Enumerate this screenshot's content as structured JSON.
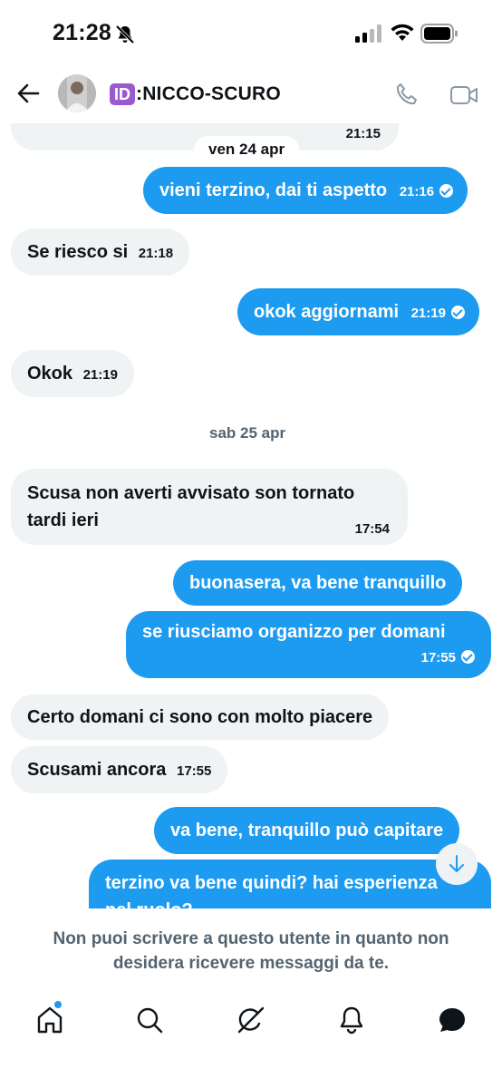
{
  "status_bar": {
    "time": "21:28"
  },
  "header": {
    "badge": "ID",
    "name": ":NICCO-SCURO"
  },
  "messages": [
    {
      "text": "",
      "time": "21:15"
    },
    {
      "text": "vieni terzino, dai ti aspetto",
      "time": "21:16"
    },
    {
      "text": "Se riesco si",
      "time": "21:18"
    },
    {
      "text": "okok aggiornami",
      "time": "21:19"
    },
    {
      "text": "Okok",
      "time": "21:19"
    },
    {
      "text_line1": "Scusa non averti avvisato son tornato",
      "text_line2": "tardi ieri",
      "time": "17:54"
    },
    {
      "text": "buonasera, va bene tranquillo"
    },
    {
      "text": "se riusciamo organizzo per domani",
      "time": "17:55"
    },
    {
      "text": "Certo domani ci sono con molto piacere"
    },
    {
      "text": "Scusami ancora",
      "time": "17:55"
    },
    {
      "text": "va bene, tranquillo può capitare"
    },
    {
      "text_line1": "terzino va bene quindi? hai esperienza",
      "text_line2": "nel ruolo?"
    }
  ],
  "dates": {
    "first": "ven 24 apr",
    "second": "sab 25 apr"
  },
  "notice": {
    "line1": "Non puoi scrivere a questo utente in quanto non",
    "line2": "desidera ricevere messaggi da te."
  },
  "colors": {
    "accent": "#1d9bf0",
    "incoming_bg": "#eff3f4",
    "muted_text": "#536471"
  },
  "icons": [
    "home-icon",
    "search-icon",
    "grok-icon",
    "notifications-icon",
    "messages-icon"
  ]
}
